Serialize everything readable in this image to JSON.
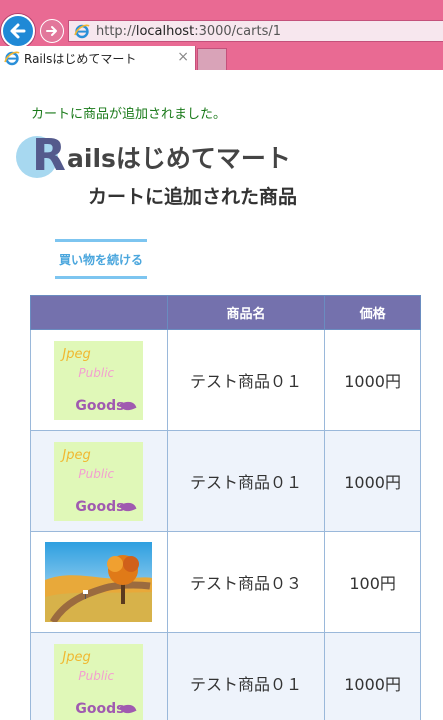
{
  "browser": {
    "url_prefix": "http://",
    "url_host": "localhost",
    "url_rest": ":3000/carts/1",
    "tab_title": "Railsはじめてマート",
    "tab_close": "×",
    "back_icon": "back-arrow-icon",
    "forward_icon": "forward-arrow-icon"
  },
  "page": {
    "notice": "カートに商品が追加されました。",
    "logo_letter": "R",
    "logo_text": "ailsはじめてマート",
    "subtitle": "カートに追加された商品",
    "continue_label": "買い物を続ける"
  },
  "table": {
    "headers": [
      "",
      "商品名",
      "価格"
    ],
    "rows": [
      {
        "image": "jpeg-public-goods",
        "name": "テスト商品０１",
        "price": "1000円"
      },
      {
        "image": "jpeg-public-goods",
        "name": "テスト商品０１",
        "price": "1000円"
      },
      {
        "image": "autumn-tree-landscape",
        "name": "テスト商品０３",
        "price": "100円"
      },
      {
        "image": "jpeg-public-goods",
        "name": "テスト商品０１",
        "price": "1000円"
      }
    ],
    "thumb_text": {
      "line1": "Jpeg",
      "line2": "Public",
      "line3": "Goods"
    }
  },
  "colors": {
    "chrome": "#e96a93",
    "notice": "#1a7a1a",
    "header_bg": "#7471ad",
    "accent": "#7dc5f0"
  }
}
